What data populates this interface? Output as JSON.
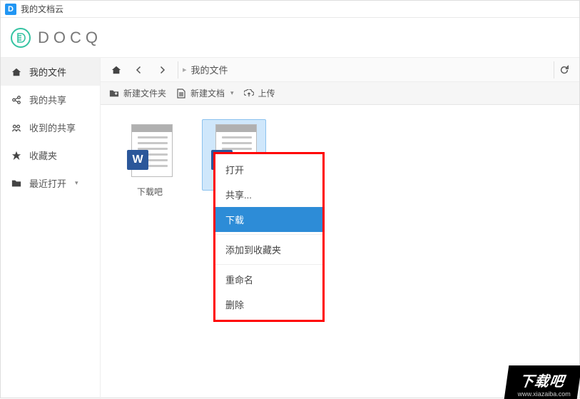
{
  "window": {
    "title": "我的文档云",
    "favicon_letter": "D"
  },
  "brand": {
    "name": "DOCQ"
  },
  "sidebar": {
    "items": [
      {
        "icon": "home-icon",
        "label": "我的文件",
        "active": true
      },
      {
        "icon": "share-icon",
        "label": "我的共享",
        "active": false
      },
      {
        "icon": "received-icon",
        "label": "收到的共享",
        "active": false
      },
      {
        "icon": "star-icon",
        "label": "收藏夹",
        "active": false
      },
      {
        "icon": "recent-icon",
        "label": "最近打开",
        "active": false,
        "has_caret": true
      }
    ]
  },
  "breadcrumb": {
    "path_label": "我的文件",
    "separator": "▸"
  },
  "toolbar": {
    "new_folder": "新建文件夹",
    "new_doc": "新建文档",
    "upload": "上传"
  },
  "files": [
    {
      "name": "下载吧",
      "type": "word",
      "selected": false
    },
    {
      "name": "",
      "type": "word",
      "selected": true
    }
  ],
  "context_menu": {
    "items": [
      {
        "label": "打开",
        "active": false
      },
      {
        "label": "共享...",
        "active": false
      },
      {
        "label": "下载",
        "active": true,
        "sep_after": true
      },
      {
        "label": "添加到收藏夹",
        "active": false,
        "sep_after": true
      },
      {
        "label": "重命名",
        "active": false
      },
      {
        "label": "删除",
        "active": false
      }
    ]
  },
  "watermark": {
    "text": "下载吧",
    "url": "www.xiazaiba.com"
  }
}
